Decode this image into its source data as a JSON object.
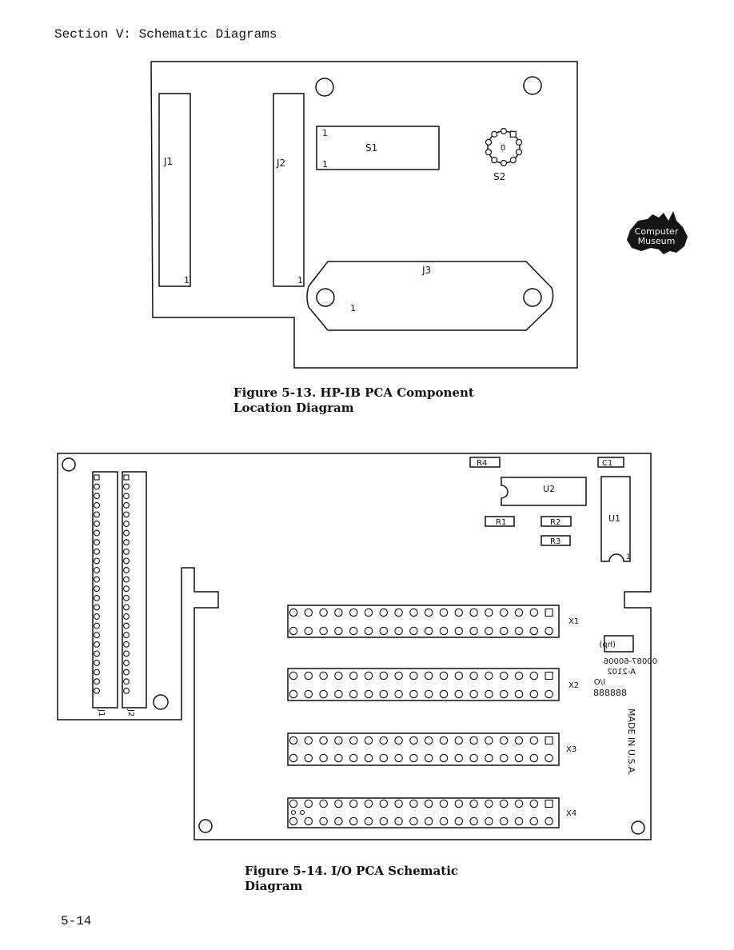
{
  "header": {
    "section_title": "Section V:  Schematic Diagrams"
  },
  "figure1": {
    "caption_line1": "Figure 5-13.  HP-IB PCA Component",
    "caption_line2": "Location Diagram",
    "labels": {
      "j1": "J1",
      "j2": "J2",
      "j3": "J3",
      "s1": "S1",
      "s2": "S2",
      "pin1": "1",
      "s2_center": "0"
    }
  },
  "figure2": {
    "caption_line1": "Figure 5-14.  I/O PCA Schematic",
    "caption_line2": "Diagram",
    "labels": {
      "r1": "R1",
      "r2": "R2",
      "r3": "R3",
      "r4": "R4",
      "c1": "C1",
      "u1": "U1",
      "u2": "U2",
      "pin1": "1",
      "x1": "X1",
      "x2": "X2",
      "x3": "X3",
      "x4": "X4",
      "j1": "J1",
      "j2": "J2"
    },
    "board_marking": {
      "logo": "(hp)",
      "part_number": "00087-60006",
      "revision": "A-2102",
      "name": "I/O",
      "code": "888888",
      "origin": "MADE IN U.S.A."
    },
    "socket_pins_per_row": 18,
    "connector_pins": 24
  },
  "watermark": {
    "line1": "Computer",
    "line2": "Museum"
  },
  "page_number": "5-14"
}
